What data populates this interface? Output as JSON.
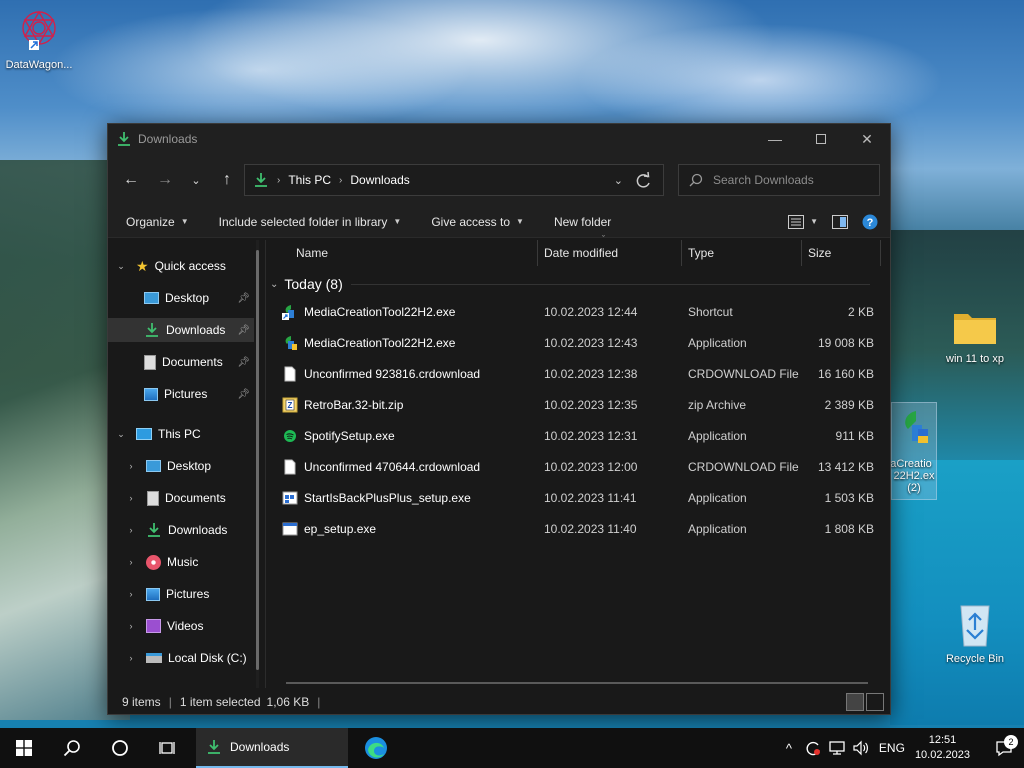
{
  "desktop": {
    "icons": {
      "datawagon": "DataWagon...",
      "folder": "win 11 to xp",
      "media_line1": "aCreatio",
      "media_line2": "22H2.ex",
      "media_line3": "(2)",
      "recycle": "Recycle Bin"
    }
  },
  "window": {
    "title": "Downloads",
    "address": {
      "crumb1": "This PC",
      "crumb2": "Downloads"
    },
    "search": {
      "placeholder": "Search Downloads"
    },
    "toolbar": {
      "organize": "Organize",
      "include": "Include selected folder in library",
      "give_access": "Give access to",
      "new_folder": "New folder"
    },
    "nav": {
      "quick_access": "Quick access",
      "qa_desktop": "Desktop",
      "qa_downloads": "Downloads",
      "qa_documents": "Documents",
      "qa_pictures": "Pictures",
      "this_pc": "This PC",
      "pc_desktop": "Desktop",
      "pc_documents": "Documents",
      "pc_downloads": "Downloads",
      "pc_music": "Music",
      "pc_pictures": "Pictures",
      "pc_videos": "Videos",
      "pc_localdisk": "Local Disk (C:)"
    },
    "columns": {
      "name": "Name",
      "date": "Date modified",
      "type": "Type",
      "size": "Size"
    },
    "group": "Today (8)",
    "files": [
      {
        "name": "MediaCreationTool22H2.exe",
        "date": "10.02.2023 12:44",
        "type": "Shortcut",
        "size": "2 KB"
      },
      {
        "name": "MediaCreationTool22H2.exe",
        "date": "10.02.2023 12:43",
        "type": "Application",
        "size": "19 008 KB"
      },
      {
        "name": "Unconfirmed 923816.crdownload",
        "date": "10.02.2023 12:38",
        "type": "CRDOWNLOAD File",
        "size": "16 160 KB"
      },
      {
        "name": "RetroBar.32-bit.zip",
        "date": "10.02.2023 12:35",
        "type": "zip Archive",
        "size": "2 389 KB"
      },
      {
        "name": "SpotifySetup.exe",
        "date": "10.02.2023 12:31",
        "type": "Application",
        "size": "911 KB"
      },
      {
        "name": "Unconfirmed 470644.crdownload",
        "date": "10.02.2023 12:00",
        "type": "CRDOWNLOAD File",
        "size": "13 412 KB"
      },
      {
        "name": "StartIsBackPlusPlus_setup.exe",
        "date": "10.02.2023 11:41",
        "type": "Application",
        "size": "1 503 KB"
      },
      {
        "name": "ep_setup.exe",
        "date": "10.02.2023 11:40",
        "type": "Application",
        "size": "1 808 KB"
      }
    ],
    "status": {
      "items": "9 items",
      "selected": "1 item selected",
      "size": "1,06 KB"
    }
  },
  "taskbar": {
    "app_label": "Downloads",
    "lang": "ENG",
    "time": "12:51",
    "date": "10.02.2023",
    "notifications": "2"
  },
  "colors": {
    "window_bg": "#191919",
    "accent_green": "#3fbf6f",
    "folder_yellow": "#f5c94a",
    "taskbar_accent": "#76b9ed"
  }
}
